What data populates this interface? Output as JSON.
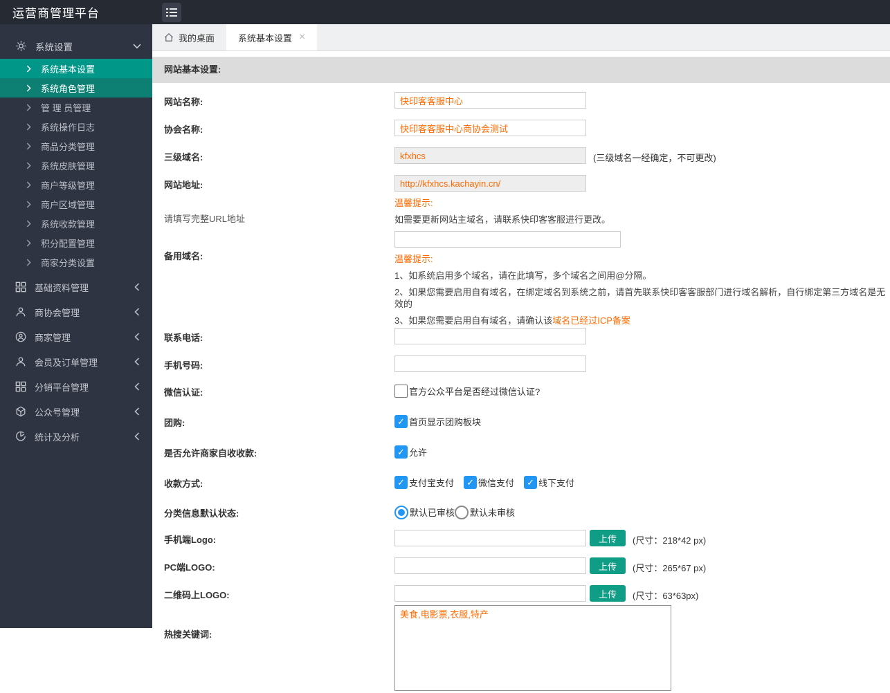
{
  "topbar": {
    "title": "运营商管理平台"
  },
  "sidebar": {
    "group": {
      "label": "系统设置"
    },
    "submenu": [
      {
        "label": "系统基本设置"
      },
      {
        "label": "系统角色管理"
      },
      {
        "label": "管 理 员管理"
      },
      {
        "label": "系统操作日志"
      },
      {
        "label": "商品分类管理"
      },
      {
        "label": "系统皮肤管理"
      },
      {
        "label": "商户等级管理"
      },
      {
        "label": "商户区域管理"
      },
      {
        "label": "系统收款管理"
      },
      {
        "label": "积分配置管理"
      },
      {
        "label": "商家分类设置"
      }
    ],
    "sections": [
      {
        "label": "基础资料管理"
      },
      {
        "label": "商协会管理"
      },
      {
        "label": "商家管理"
      },
      {
        "label": "会员及订单管理"
      },
      {
        "label": "分销平台管理"
      },
      {
        "label": "公众号管理"
      },
      {
        "label": "统计及分析"
      }
    ]
  },
  "tabs": [
    {
      "label": "我的桌面"
    },
    {
      "label": "系统基本设置"
    }
  ],
  "panel": {
    "title": "网站基本设置:"
  },
  "form": {
    "site_name": {
      "label": "网站名称:",
      "value": "快印客客服中心"
    },
    "assoc_name": {
      "label": "协会名称:",
      "value": "快印客客服中心商协会测试"
    },
    "subdomain": {
      "label": "三级域名:",
      "value": "kfxhcs",
      "hint": "(三级域名一经确定，不可更改)"
    },
    "site_url": {
      "label": "网站地址:",
      "sublabel": "请填写完整URL地址",
      "value": "http://kfxhcs.kachayin.cn/",
      "tip_title": "温馨提示:",
      "tip": "如需要更新网站主域名，请联系快印客客服进行更改。"
    },
    "backup_domain": {
      "label": "备用域名:",
      "value": "",
      "tip_title": "温馨提示:",
      "tip1": "1、如系统启用多个域名，请在此填写，多个域名之间用@分隔。",
      "tip2": "2、如果您需要启用自有域名，在绑定域名到系统之前，请首先联系快印客客服部门进行域名解析，自行绑定第三方域名是无效的",
      "tip3_prefix": "3、如果您需要启用自有域名，请确认该",
      "tip3_link": "域名已经过ICP备案"
    },
    "phone": {
      "label": "联系电话:",
      "value": ""
    },
    "mobile": {
      "label": "手机号码:",
      "value": ""
    },
    "wechat_cert": {
      "label": "微信认证:",
      "option": "官方公众平台是否经过微信认证?"
    },
    "groupon": {
      "label": "团购:",
      "option": "首页显示团购板块",
      "check": "✓"
    },
    "merchant_collect": {
      "label": "是否允许商家自收收款:",
      "option": "允许",
      "check": "✓"
    },
    "pay_methods": {
      "label": "收款方式:",
      "options": [
        "支付宝支付",
        "微信支付",
        "线下支付"
      ],
      "check": "✓"
    },
    "info_status": {
      "label": "分类信息默认状态:",
      "options": [
        "默认已审核",
        "默认未审核"
      ],
      "selected": "默认已审核"
    },
    "mobile_logo": {
      "label": "手机端Logo:",
      "value": "",
      "button": "上传",
      "hint": "(尺寸：218*42 px)"
    },
    "pc_logo": {
      "label": "PC端LOGO:",
      "value": "",
      "button": "上传",
      "hint": "(尺寸：265*67 px)"
    },
    "qr_logo": {
      "label": "二维码上LOGO:",
      "value": "",
      "button": "上传",
      "hint": "(尺寸：63*63px)"
    },
    "hot_keywords": {
      "label": "热搜关键词:",
      "value": "美食,电影票,衣服,特产"
    }
  },
  "colors": {
    "sidebar_active": "#009688",
    "sidebar_active_alt": "#0d8073",
    "checkbox_blue": "#2196f3",
    "upload_teal": "#0f9d86",
    "value_orange": "#ff6a00"
  }
}
